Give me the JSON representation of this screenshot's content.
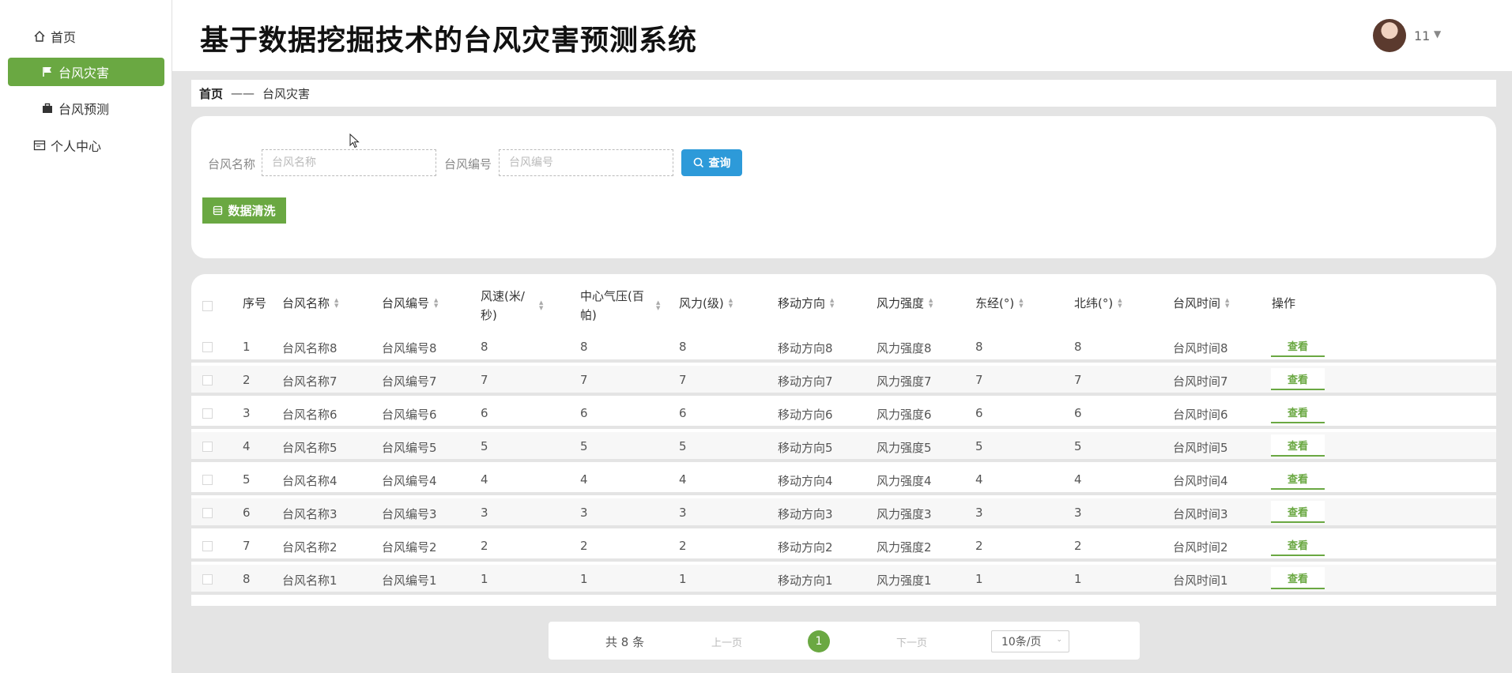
{
  "app": {
    "title": "基于数据挖掘技术的台风灾害预测系统",
    "accent_color": "#6aa842",
    "search_button_color": "#2d9ad9"
  },
  "user": {
    "name": "11",
    "avatar_icon": "user-avatar"
  },
  "sidebar": {
    "items": [
      {
        "label": "首页",
        "icon": "home-icon",
        "active": false
      },
      {
        "label": "台风灾害",
        "icon": "flag-icon",
        "active": true
      },
      {
        "label": "台风预测",
        "icon": "briefcase-icon",
        "active": false
      },
      {
        "label": "个人中心",
        "icon": "id-card-icon",
        "active": false
      }
    ]
  },
  "breadcrumb": {
    "home": "首页",
    "separator": "——",
    "current": "台风灾害"
  },
  "search": {
    "name_label": "台风名称",
    "name_placeholder": "台风名称",
    "code_label": "台风编号",
    "code_placeholder": "台风编号",
    "search_button": "查询",
    "clean_button": "数据清洗"
  },
  "table": {
    "columns": [
      "序号",
      "台风名称",
      "台风编号",
      "风速(米/秒)",
      "中心气压(百帕)",
      "风力(级)",
      "移动方向",
      "风力强度",
      "东经(°)",
      "北纬(°)",
      "台风时间",
      "操作"
    ],
    "rows": [
      {
        "idx": "1",
        "name": "台风名称8",
        "code": "台风编号8",
        "speed": "8",
        "pressure": "8",
        "force": "8",
        "direction": "移动方向8",
        "strength": "风力强度8",
        "lon": "8",
        "lat": "8",
        "time": "台风时间8",
        "action": "查看"
      },
      {
        "idx": "2",
        "name": "台风名称7",
        "code": "台风编号7",
        "speed": "7",
        "pressure": "7",
        "force": "7",
        "direction": "移动方向7",
        "strength": "风力强度7",
        "lon": "7",
        "lat": "7",
        "time": "台风时间7",
        "action": "查看"
      },
      {
        "idx": "3",
        "name": "台风名称6",
        "code": "台风编号6",
        "speed": "6",
        "pressure": "6",
        "force": "6",
        "direction": "移动方向6",
        "strength": "风力强度6",
        "lon": "6",
        "lat": "6",
        "time": "台风时间6",
        "action": "查看"
      },
      {
        "idx": "4",
        "name": "台风名称5",
        "code": "台风编号5",
        "speed": "5",
        "pressure": "5",
        "force": "5",
        "direction": "移动方向5",
        "strength": "风力强度5",
        "lon": "5",
        "lat": "5",
        "time": "台风时间5",
        "action": "查看"
      },
      {
        "idx": "5",
        "name": "台风名称4",
        "code": "台风编号4",
        "speed": "4",
        "pressure": "4",
        "force": "4",
        "direction": "移动方向4",
        "strength": "风力强度4",
        "lon": "4",
        "lat": "4",
        "time": "台风时间4",
        "action": "查看"
      },
      {
        "idx": "6",
        "name": "台风名称3",
        "code": "台风编号3",
        "speed": "3",
        "pressure": "3",
        "force": "3",
        "direction": "移动方向3",
        "strength": "风力强度3",
        "lon": "3",
        "lat": "3",
        "time": "台风时间3",
        "action": "查看"
      },
      {
        "idx": "7",
        "name": "台风名称2",
        "code": "台风编号2",
        "speed": "2",
        "pressure": "2",
        "force": "2",
        "direction": "移动方向2",
        "strength": "风力强度2",
        "lon": "2",
        "lat": "2",
        "time": "台风时间2",
        "action": "查看"
      },
      {
        "idx": "8",
        "name": "台风名称1",
        "code": "台风编号1",
        "speed": "1",
        "pressure": "1",
        "force": "1",
        "direction": "移动方向1",
        "strength": "风力强度1",
        "lon": "1",
        "lat": "1",
        "time": "台风时间1",
        "action": "查看"
      }
    ]
  },
  "pagination": {
    "total": "共 8 条",
    "prev": "上一页",
    "current": "1",
    "next": "下一页",
    "page_size": "10条/页"
  }
}
